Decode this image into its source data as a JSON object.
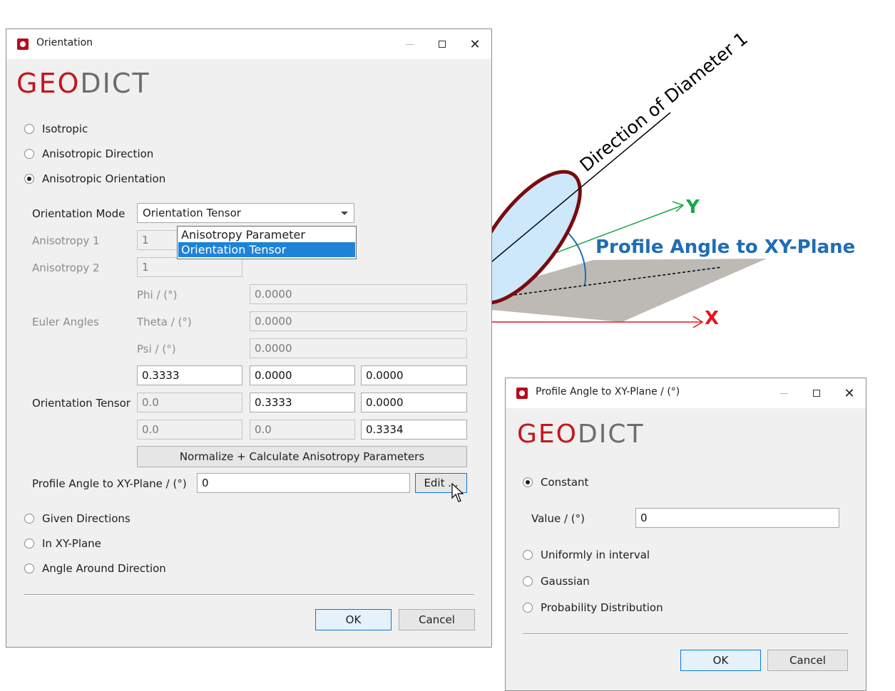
{
  "dialog1": {
    "title": "Orientation",
    "logo_geo": "GEO",
    "logo_dict": "DICT",
    "radios": {
      "isotropic": "Isotropic",
      "aniso_direction": "Anisotropic Direction",
      "aniso_orientation": "Anisotropic Orientation",
      "given_directions": "Given Directions",
      "in_xy_plane": "In XY-Plane",
      "angle_around": "Angle Around Direction"
    },
    "selected_radio": "Anisotropic Orientation",
    "orientation_mode_label": "Orientation Mode",
    "orientation_mode_value": "Orientation Tensor",
    "dropdown_options": [
      "Anisotropy Parameter",
      "Orientation Tensor"
    ],
    "anisotropy1_label": "Anisotropy 1",
    "anisotropy1_value": "1",
    "anisotropy2_label": "Anisotropy 2",
    "anisotropy2_value": "1",
    "euler_label": "Euler Angles",
    "phi_label": "Phi / (°)",
    "phi_value": "0.0000",
    "theta_label": "Theta / (°)",
    "theta_value": "0.0000",
    "psi_label": "Psi / (°)",
    "psi_value": "0.0000",
    "tensor_label": "Orientation Tensor",
    "tensor": [
      [
        "0.3333",
        "0.0000",
        "0.0000"
      ],
      [
        "0.0",
        "0.3333",
        "0.0000"
      ],
      [
        "0.0",
        "0.0",
        "0.3334"
      ]
    ],
    "normalize_button": "Normalize + Calculate Anisotropy Parameters",
    "profile_label": "Profile Angle to XY-Plane / (°)",
    "profile_value": "0",
    "edit_button": "Edit ...",
    "ok": "OK",
    "cancel": "Cancel"
  },
  "dialog2": {
    "title": "Profile Angle to XY-Plane / (°)",
    "logo_geo": "GEO",
    "logo_dict": "DICT",
    "constant": "Constant",
    "value_label": "Value / (°)",
    "value": "0",
    "uniform": "Uniformly in interval",
    "gaussian": "Gaussian",
    "probability": "Probability Distribution",
    "selected_radio": "Constant",
    "ok": "OK",
    "cancel": "Cancel"
  },
  "diagram": {
    "direction_label": "Direction of Diameter 1",
    "y_label": "Y",
    "x_label": "X",
    "angle_label": "Profile Angle to XY-Plane",
    "colors": {
      "x_axis": "#e8141e",
      "y_axis": "#1aa64a",
      "angle": "#1f6db5",
      "ellipse_stroke": "#7a0a0e",
      "ellipse_fill": "#cde8fb",
      "plane": "#bdbab5"
    }
  }
}
